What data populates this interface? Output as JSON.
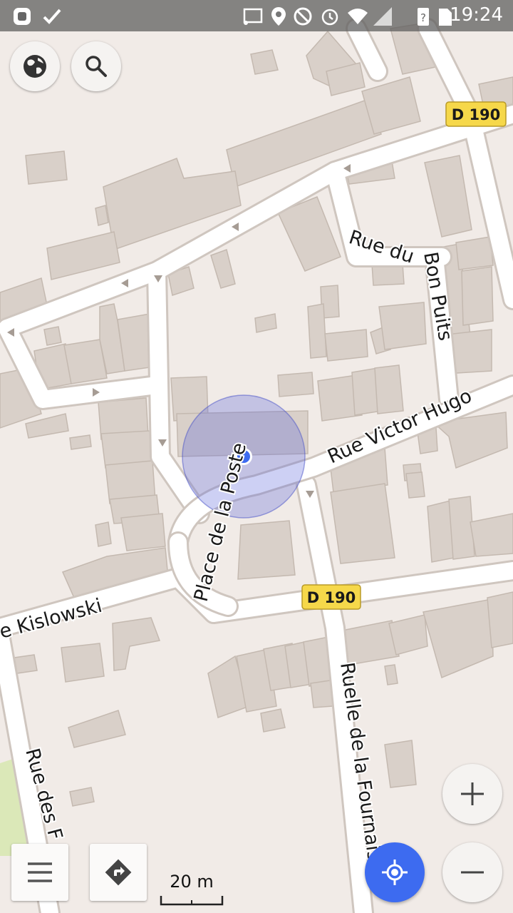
{
  "status_bar": {
    "time": "19:24",
    "icons": [
      "android-icon",
      "check-notification-icon",
      "cast-icon",
      "location-pin-icon",
      "do-not-disturb-icon",
      "alarm-icon",
      "wifi-icon",
      "cell-signal-icon",
      "battery-unknown-icon",
      "sd-card-icon"
    ]
  },
  "map": {
    "road_labels": {
      "rue_victor_hugo": "Rue Victor Hugo",
      "place_de_la_poste": "Place de la Poste",
      "rue_du_bon_puits": "Rue du Bon Puits",
      "rue_kislowski": "e Kislowski",
      "ruelle_de_la_fournaise": "Ruelle de la Fournaise",
      "rue_des": "Rue des F"
    },
    "route_shields": {
      "d190_top": "D 190",
      "d190_middle": "D 190"
    },
    "colors": {
      "background": "#f1ebe7",
      "building": "#d9d0c9",
      "building_stroke": "#c4b9b0",
      "road": "#ffffff",
      "road_casing": "#cfc6bf",
      "park": "#dbe8b8",
      "shield": "#f6d84a",
      "location_accent": "#3d6bf0"
    }
  },
  "controls": {
    "layers_icon": "globe-icon",
    "search_icon": "search-icon",
    "zoom_in_icon": "plus-icon",
    "zoom_out_icon": "minus-icon",
    "menu_icon": "hamburger-icon",
    "directions_icon": "directions-icon",
    "my_location_icon": "crosshair-icon"
  },
  "scale_bar": {
    "label": "20 m"
  }
}
